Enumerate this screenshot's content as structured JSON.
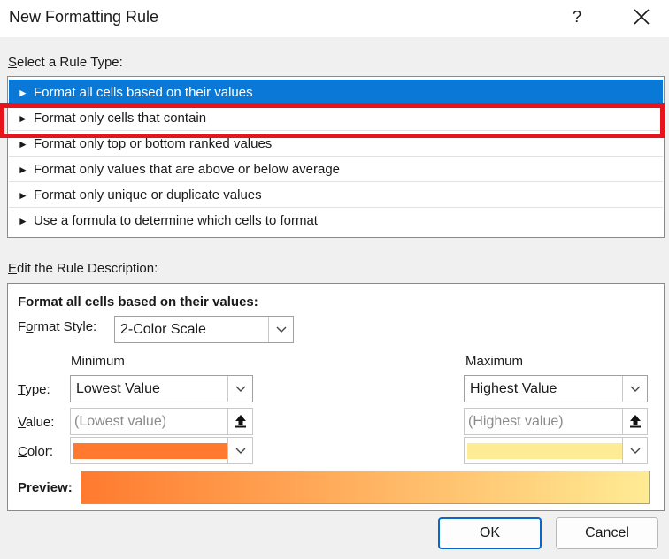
{
  "window": {
    "title": "New Formatting Rule",
    "help_label": "?"
  },
  "rule_type": {
    "label_underlined": "S",
    "label_rest": "elect a Rule Type:",
    "items": [
      {
        "label": "Format all cells based on their values",
        "selected": true
      },
      {
        "label": "Format only cells that contain",
        "highlighted": true
      },
      {
        "label": "Format only top or bottom ranked values"
      },
      {
        "label": "Format only values that are above or below average"
      },
      {
        "label": "Format only unique or duplicate values"
      },
      {
        "label": "Use a formula to determine which cells to format"
      }
    ]
  },
  "description": {
    "label_underlined": "E",
    "label_rest": "dit the Rule Description:",
    "heading": "Format all cells based on their values:",
    "format_style_label_a": "F",
    "format_style_label_u": "o",
    "format_style_label_b": "rmat Style:",
    "format_style_value": "2-Color Scale",
    "minimum_label": "Minimum",
    "maximum_label": "Maximum",
    "type_label_u": "T",
    "type_label_rest": "ype:",
    "value_label_u": "V",
    "value_label_rest": "alue:",
    "color_label_u": "C",
    "color_label_rest": "olor:",
    "min_type": "Lowest Value",
    "max_type": "Highest Value",
    "min_value_placeholder": "(Lowest value)",
    "max_value_placeholder": "(Highest value)",
    "min_color": "#ff7a2e",
    "max_color": "#ffeb94",
    "preview_label": "Preview:",
    "preview_gradient": [
      "#ff7a2e",
      "#ffeb94"
    ]
  },
  "buttons": {
    "ok": "OK",
    "cancel": "Cancel"
  },
  "colors": {
    "selection": "#0a78d7",
    "highlight_box": "#e8141c"
  }
}
